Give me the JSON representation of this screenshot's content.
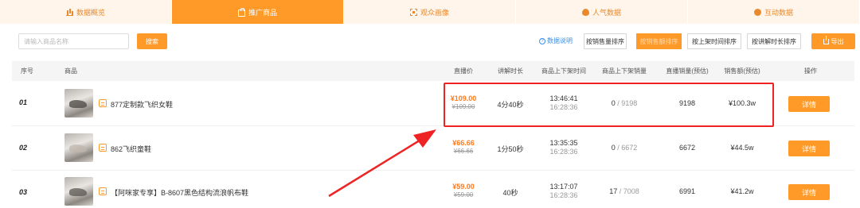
{
  "tabs": [
    {
      "label": "数据概览",
      "icon": "bar-chart-icon",
      "active": false
    },
    {
      "label": "推广商品",
      "icon": "shopping-bag-icon",
      "active": true
    },
    {
      "label": "观众画像",
      "icon": "scan-icon",
      "active": false
    },
    {
      "label": "人气数据",
      "icon": "fire-icon",
      "active": false
    },
    {
      "label": "互动数据",
      "icon": "chat-icon",
      "active": false
    }
  ],
  "toolbar": {
    "search_placeholder": "请输入商品名称",
    "search_value": "",
    "search_button": "搜索",
    "help_label": "数据说明",
    "sort_buttons": [
      "按销售量排序",
      "按销售额排序",
      "按上架时间排序",
      "按讲解时长排序"
    ],
    "active_sort": "按销售额排序",
    "export_label": "导出"
  },
  "table": {
    "columns": [
      "序号",
      "商品",
      "直播价",
      "讲解时长",
      "商品上下架时间",
      "商品上下架销量",
      "直播销量(预估)",
      "销售额(预估)",
      "操作"
    ],
    "rows": [
      {
        "index": "01",
        "name": "877定制款飞织女鞋",
        "price": "¥109.00",
        "original_price": "¥109.00",
        "duration": "4分40秒",
        "time_on": "13:46:41",
        "time_off": "16:28:36",
        "stock_sold": "0",
        "stock_total": "9198",
        "live_sales": "9198",
        "revenue": "¥100.3w",
        "action": "详情"
      },
      {
        "index": "02",
        "name": "862飞织童鞋",
        "price": "¥66.66",
        "original_price": "¥66.66",
        "duration": "1分50秒",
        "time_on": "13:35:35",
        "time_off": "16:28:36",
        "stock_sold": "0",
        "stock_total": "6672",
        "live_sales": "6672",
        "revenue": "¥44.5w",
        "action": "详情"
      },
      {
        "index": "03",
        "name": "【阿咪家专享】B-8607黑色结构流浪帆布鞋",
        "price": "¥59.00",
        "original_price": "¥59.00",
        "duration": "40秒",
        "time_on": "13:17:07",
        "time_off": "16:28:36",
        "stock_sold": "17",
        "stock_total": "7008",
        "live_sales": "6991",
        "revenue": "¥41.2w",
        "action": "详情"
      }
    ]
  },
  "colors": {
    "accent": "#ff9a28",
    "highlight": "#ee2424",
    "link": "#3a8ee6"
  }
}
